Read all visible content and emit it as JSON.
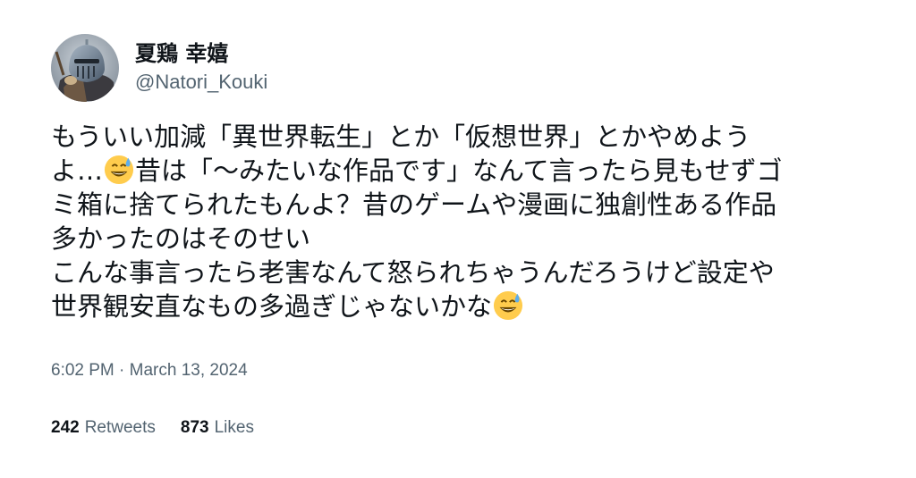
{
  "author": {
    "display_name": "夏鶏 幸嬉",
    "handle": "@Natori_Kouki",
    "avatar_icon": "knight-helmet-avatar"
  },
  "tweet": {
    "lines": [
      "もういい加減「異世界転生」とか「仮想世界」とかやめよう",
      "よ…",
      "昔は「〜みたいな作品です」なんて言ったら見もせずゴ",
      "ミ箱に捨てられたもんよ？昔のゲームや漫画に独創性ある作品",
      "多かったのはそのせい",
      "こんな事言ったら老害なんて怒られちゃうんだろうけど設定や",
      "世界観安直なもの多過ぎじゃないかな"
    ],
    "emoji": "grinning-face-with-sweat-emoji",
    "timestamp": "6:02 PM · March 13, 2024"
  },
  "stats": {
    "retweets_count": "242",
    "retweets_label": "Retweets",
    "likes_count": "873",
    "likes_label": "Likes"
  }
}
